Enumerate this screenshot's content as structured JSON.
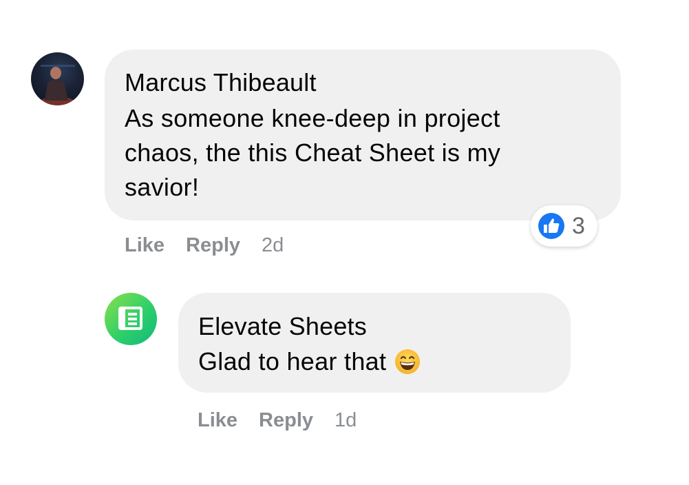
{
  "comments": [
    {
      "author": "Marcus Thibeault",
      "text": "As someone knee-deep in project chaos, the this Cheat Sheet is my savior!",
      "actions": {
        "like": "Like",
        "reply": "Reply",
        "time": "2d"
      },
      "reactions": {
        "icon": "like-icon",
        "count": "3",
        "color": "#1877f2"
      }
    },
    {
      "author": "Elevate Sheets",
      "text": "Glad to hear that",
      "emoji": "grinning-face-icon",
      "actions": {
        "like": "Like",
        "reply": "Reply",
        "time": "1d"
      }
    }
  ],
  "colors": {
    "bubble": "#f0f0f0",
    "meta_text": "#8a8d91",
    "like_blue": "#1877f2"
  }
}
